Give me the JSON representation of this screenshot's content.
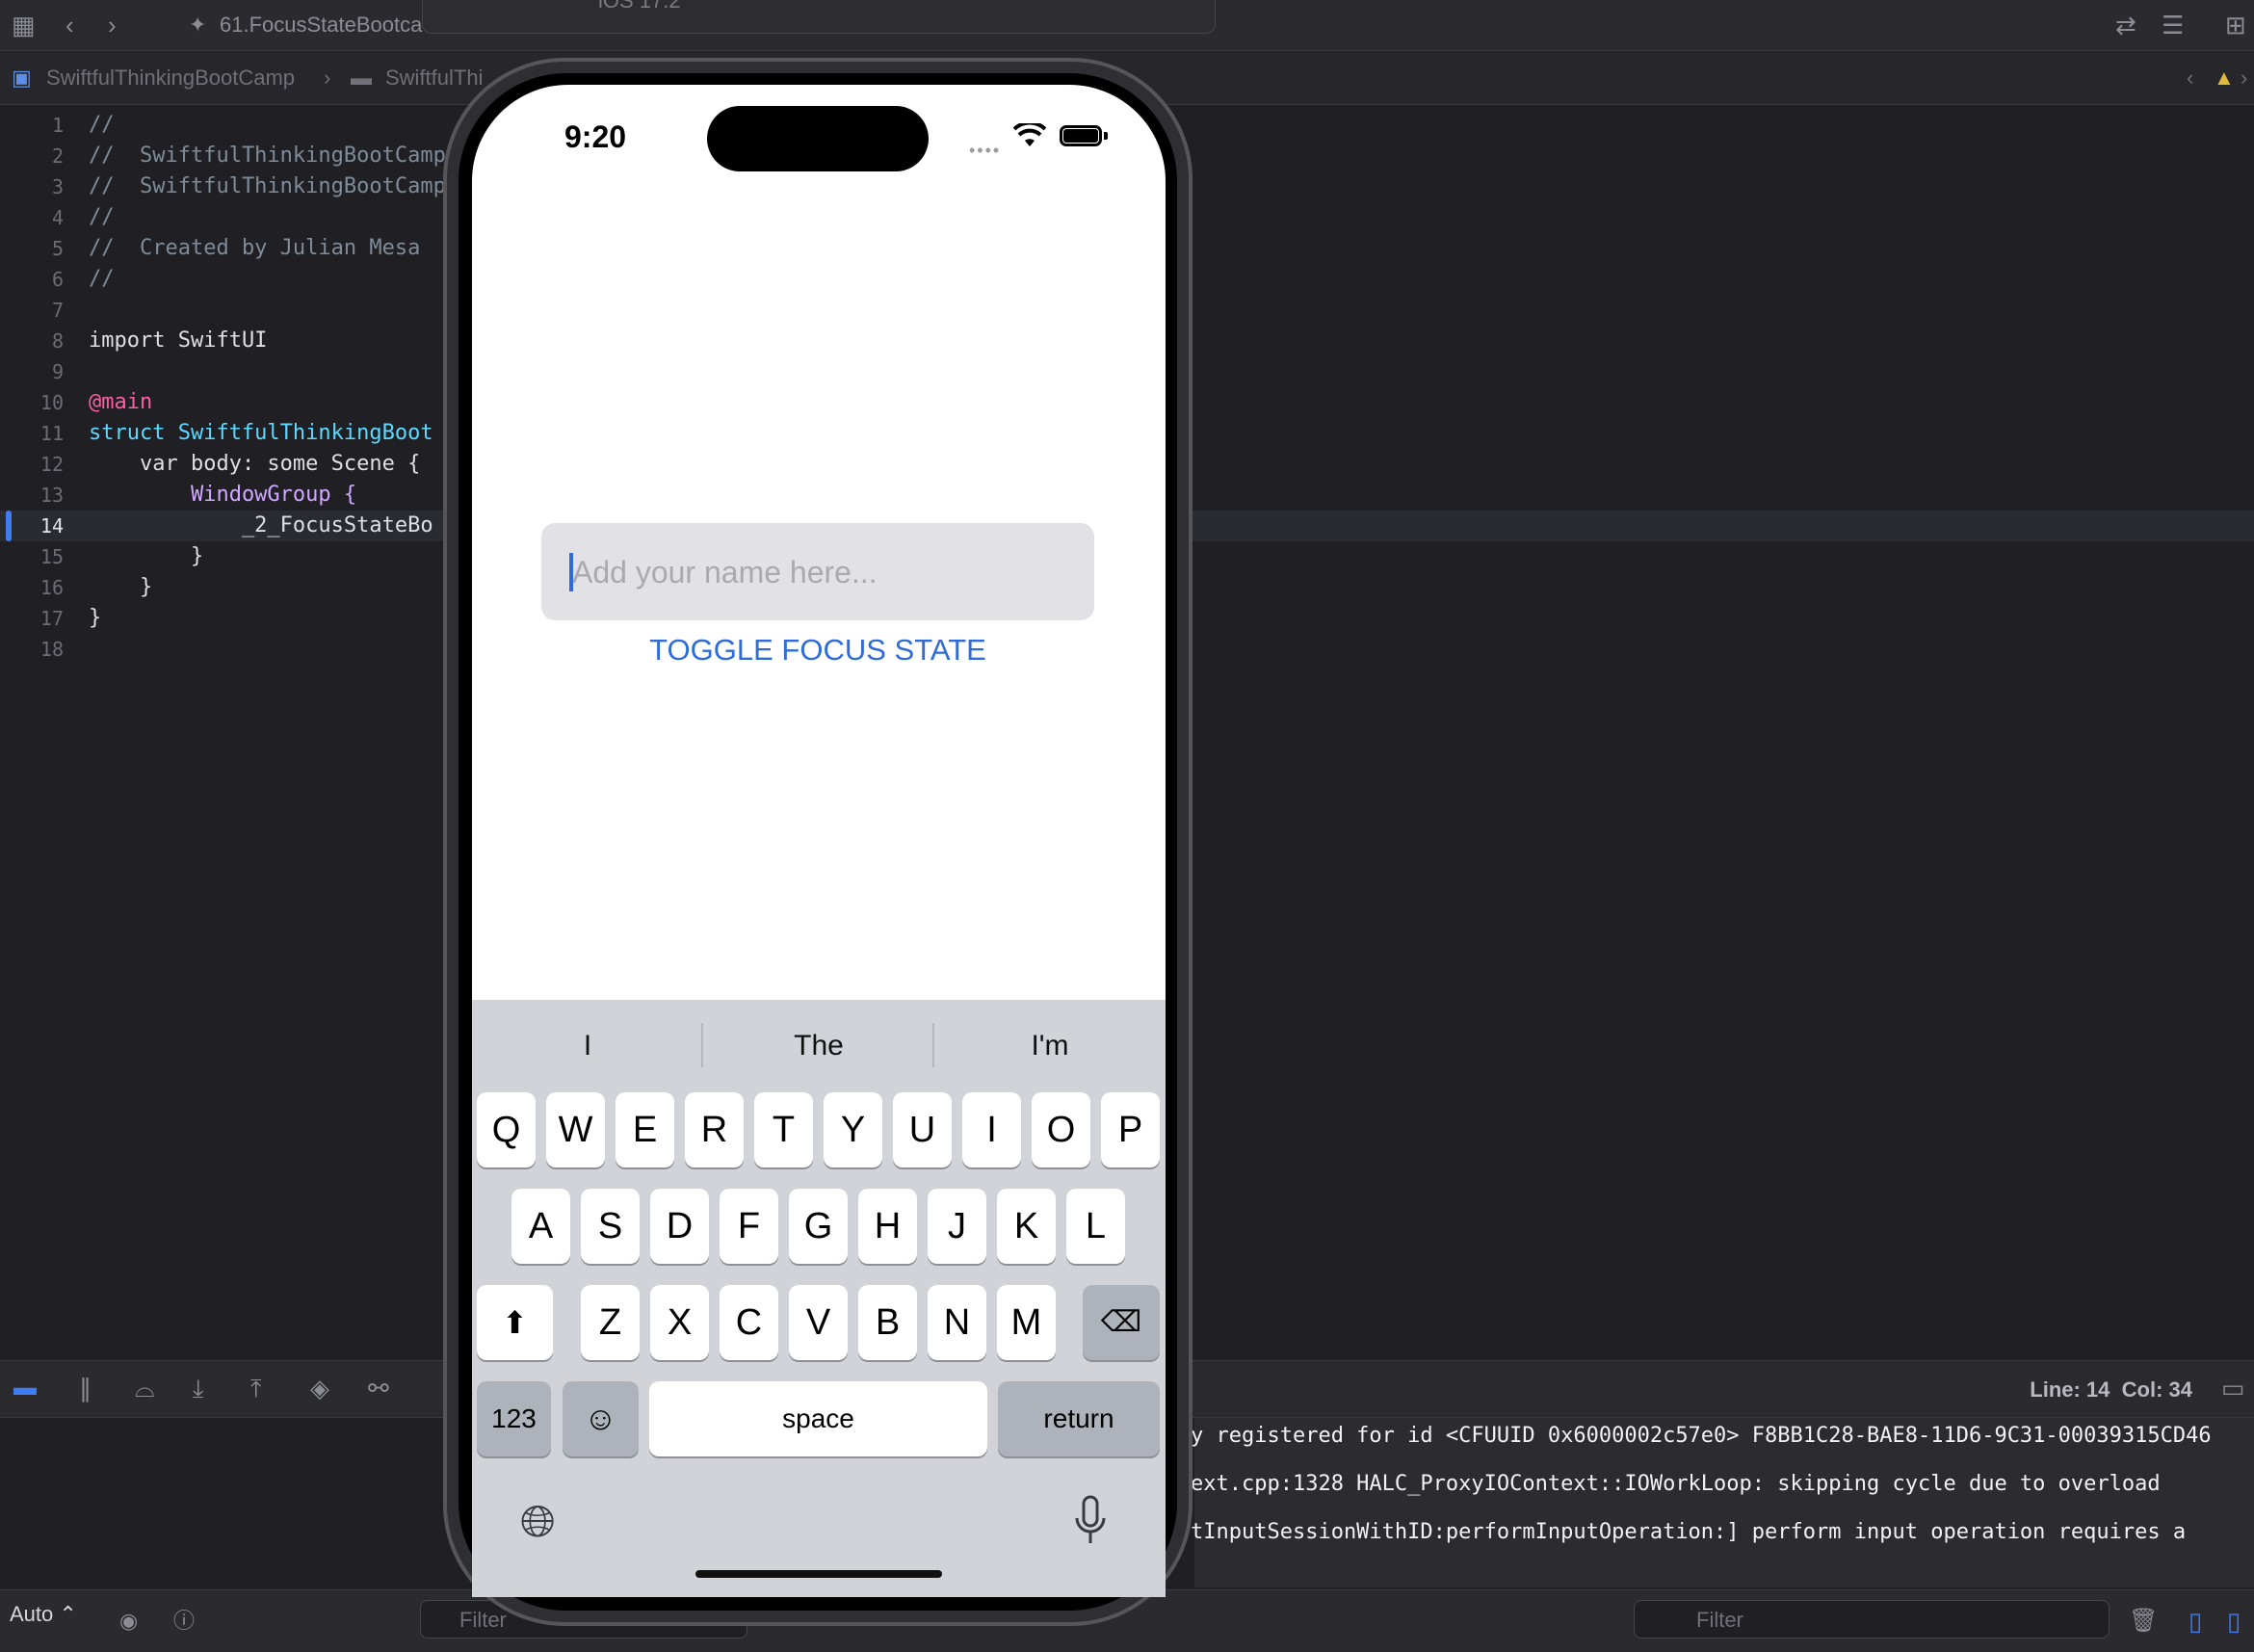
{
  "xcode": {
    "tab_title": "61.FocusStateBootca",
    "breadcrumb": [
      "SwiftfulThinkingBootCamp",
      "SwiftfulThi"
    ],
    "sim_runtime": "iOS 17.2",
    "code_lines": [
      "//",
      "//  SwiftfulThinkingBootCamp",
      "//  SwiftfulThinkingBootCamp",
      "//",
      "//  Created by Julian Mesa",
      "//",
      "",
      "import SwiftUI",
      "",
      "@main",
      "struct SwiftfulThinkingBoot",
      "    var body: some Scene {",
      "        WindowGroup {",
      "            _2_FocusStateBo",
      "        }",
      "    }",
      "}",
      ""
    ],
    "current_line": 14,
    "status_line": "Line: 14",
    "status_col": "Col: 34",
    "console_lines": [
      "y registered for id <CFUUID 0x6000002c57e0> F8BB1C28-BAE8-11D6-9C31-00039315CD46",
      "ext.cpp:1328  HALC_ProxyIOContext::IOWorkLoop: skipping cycle due to overload",
      "tInputSessionWithID:performInputOperation:]  perform input operation requires a"
    ],
    "auto_label": "Auto",
    "filter_left": "Filter",
    "filter_right": "Filter"
  },
  "phone": {
    "time": "9:20",
    "textfield_placeholder": "Add your name here...",
    "toggle_button": "TOGGLE FOCUS STATE",
    "suggestions": [
      "I",
      "The",
      "I'm"
    ],
    "keys_row1": [
      "Q",
      "W",
      "E",
      "R",
      "T",
      "Y",
      "U",
      "I",
      "O",
      "P"
    ],
    "keys_row2": [
      "A",
      "S",
      "D",
      "F",
      "G",
      "H",
      "J",
      "K",
      "L"
    ],
    "keys_row3": [
      "Z",
      "X",
      "C",
      "V",
      "B",
      "N",
      "M"
    ],
    "key_123": "123",
    "key_space": "space",
    "key_return": "return",
    "accent_color": "#2f6bd9"
  }
}
